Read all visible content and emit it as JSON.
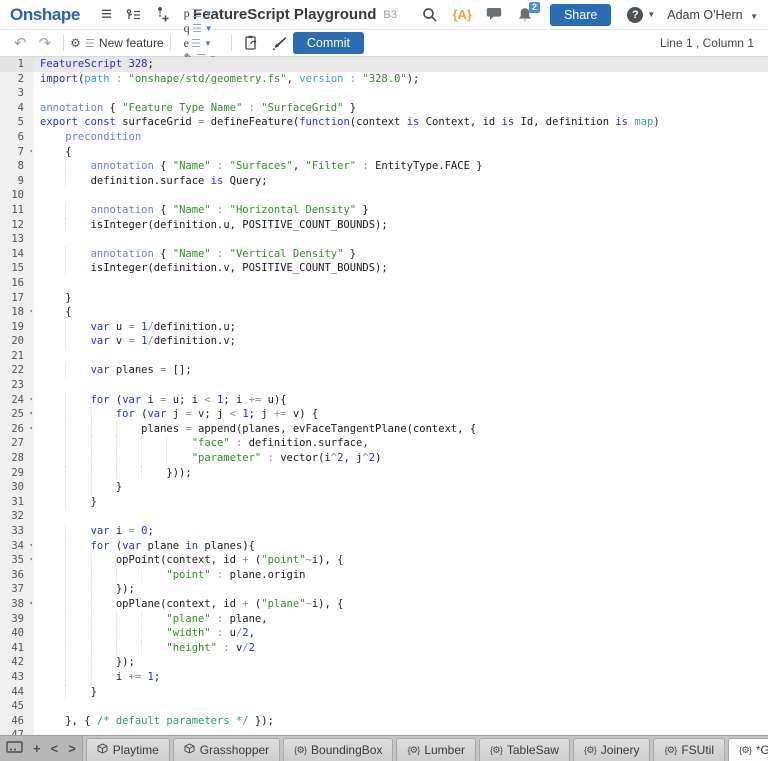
{
  "header": {
    "logo": "Onshape",
    "title": "FeatureScript Playground",
    "version_label": "B3",
    "fs_notices_label": "{A}",
    "notification_count": "2",
    "share_label": "Share",
    "help_label": "?",
    "user_name": "Adam O'Hern"
  },
  "toolbar": {
    "new_feature_label": "New feature",
    "snippet_buttons": [
      {
        "glyph": "p",
        "name": "toolbar-dropdown-p"
      },
      {
        "glyph": "q",
        "name": "toolbar-dropdown-q"
      },
      {
        "glyph": "e",
        "name": "toolbar-dropdown-e"
      },
      {
        "glyph": "✎",
        "name": "toolbar-dropdown-pencil"
      },
      {
        "glyph": "▣",
        "name": "toolbar-dropdown-box"
      }
    ],
    "commit_label": "Commit",
    "cursor_position": "Line 1 , Column 1"
  },
  "colors": {
    "accent_blue": "#2a6db4",
    "logo_blue": "#2b62b8",
    "badge_blue": "#4a90d9",
    "notice_orange": "#f2a33c",
    "keyword": "#2230d8",
    "string": "#2f8f23",
    "annotation": "#6b7edb",
    "parameter": "#3ba3c5",
    "comment": "#2f9b6b",
    "operator": "#8a8a8a"
  },
  "editor": {
    "lines": [
      {
        "n": 1,
        "ind": 0,
        "active": true,
        "t": [
          [
            "kw",
            "FeatureScript"
          ],
          [
            "pl",
            " "
          ],
          [
            "num",
            "328"
          ],
          [
            "pl",
            ";"
          ]
        ]
      },
      {
        "n": 2,
        "ind": 0,
        "t": [
          [
            "kw",
            "import"
          ],
          [
            "pl",
            "("
          ],
          [
            "par",
            "path"
          ],
          [
            "op",
            " : "
          ],
          [
            "str",
            "\"onshape/std/geometry.fs\""
          ],
          [
            "pl",
            ", "
          ],
          [
            "par",
            "version"
          ],
          [
            "op",
            " : "
          ],
          [
            "str",
            "\"328.0\""
          ],
          [
            "pl",
            ");"
          ]
        ]
      },
      {
        "n": 3,
        "ind": 0,
        "t": []
      },
      {
        "n": 4,
        "ind": 0,
        "t": [
          [
            "ann",
            "annotation"
          ],
          [
            "pl",
            " { "
          ],
          [
            "str",
            "\"Feature Type Name\""
          ],
          [
            "op",
            " : "
          ],
          [
            "str",
            "\"SurfaceGrid\""
          ],
          [
            "pl",
            " }"
          ]
        ]
      },
      {
        "n": 5,
        "ind": 0,
        "t": [
          [
            "kw",
            "export"
          ],
          [
            "pl",
            " "
          ],
          [
            "kw",
            "const"
          ],
          [
            "pl",
            " surfaceGrid "
          ],
          [
            "op",
            "="
          ],
          [
            "pl",
            " defineFeature("
          ],
          [
            "kw",
            "function"
          ],
          [
            "pl",
            "(context "
          ],
          [
            "kw",
            "is"
          ],
          [
            "pl",
            " Context, id "
          ],
          [
            "kw",
            "is"
          ],
          [
            "pl",
            " Id, definition "
          ],
          [
            "kw",
            "is"
          ],
          [
            "pl",
            " "
          ],
          [
            "par",
            "map"
          ],
          [
            "pl",
            ")"
          ]
        ]
      },
      {
        "n": 6,
        "ind": 4,
        "t": [
          [
            "ann",
            "precondition"
          ]
        ]
      },
      {
        "n": 7,
        "ind": 4,
        "fold": true,
        "t": [
          [
            "pl",
            "{"
          ]
        ]
      },
      {
        "n": 8,
        "ind": 8,
        "t": [
          [
            "ann",
            "annotation"
          ],
          [
            "pl",
            " { "
          ],
          [
            "str",
            "\"Name\""
          ],
          [
            "op",
            " : "
          ],
          [
            "str",
            "\"Surfaces\""
          ],
          [
            "pl",
            ", "
          ],
          [
            "str",
            "\"Filter\""
          ],
          [
            "op",
            " : "
          ],
          [
            "pl",
            "EntityType.FACE }"
          ]
        ]
      },
      {
        "n": 9,
        "ind": 8,
        "t": [
          [
            "pl",
            "definition.surface "
          ],
          [
            "kw",
            "is"
          ],
          [
            "pl",
            " Query;"
          ]
        ]
      },
      {
        "n": 10,
        "ind": 0,
        "t": []
      },
      {
        "n": 11,
        "ind": 8,
        "t": [
          [
            "ann",
            "annotation"
          ],
          [
            "pl",
            " { "
          ],
          [
            "str",
            "\"Name\""
          ],
          [
            "op",
            " : "
          ],
          [
            "str",
            "\"Horizontal Density\""
          ],
          [
            "pl",
            " }"
          ]
        ]
      },
      {
        "n": 12,
        "ind": 8,
        "t": [
          [
            "pl",
            "isInteger(definition.u, POSITIVE_COUNT_BOUNDS);"
          ]
        ]
      },
      {
        "n": 13,
        "ind": 0,
        "t": []
      },
      {
        "n": 14,
        "ind": 8,
        "t": [
          [
            "ann",
            "annotation"
          ],
          [
            "pl",
            " { "
          ],
          [
            "str",
            "\"Name\""
          ],
          [
            "op",
            " : "
          ],
          [
            "str",
            "\"Vertical Density\""
          ],
          [
            "pl",
            " }"
          ]
        ]
      },
      {
        "n": 15,
        "ind": 8,
        "t": [
          [
            "pl",
            "isInteger(definition.v, POSITIVE_COUNT_BOUNDS);"
          ]
        ]
      },
      {
        "n": 16,
        "ind": 0,
        "t": []
      },
      {
        "n": 17,
        "ind": 4,
        "t": [
          [
            "pl",
            "}"
          ]
        ]
      },
      {
        "n": 18,
        "ind": 4,
        "fold": true,
        "t": [
          [
            "pl",
            "{"
          ]
        ]
      },
      {
        "n": 19,
        "ind": 8,
        "t": [
          [
            "kw",
            "var"
          ],
          [
            "pl",
            " u "
          ],
          [
            "op",
            "="
          ],
          [
            "pl",
            " "
          ],
          [
            "num",
            "1"
          ],
          [
            "op",
            "/"
          ],
          [
            "pl",
            "definition.u;"
          ]
        ]
      },
      {
        "n": 20,
        "ind": 8,
        "t": [
          [
            "kw",
            "var"
          ],
          [
            "pl",
            " v "
          ],
          [
            "op",
            "="
          ],
          [
            "pl",
            " "
          ],
          [
            "num",
            "1"
          ],
          [
            "op",
            "/"
          ],
          [
            "pl",
            "definition.v;"
          ]
        ]
      },
      {
        "n": 21,
        "ind": 0,
        "t": []
      },
      {
        "n": 22,
        "ind": 8,
        "t": [
          [
            "kw",
            "var"
          ],
          [
            "pl",
            " planes "
          ],
          [
            "op",
            "="
          ],
          [
            "pl",
            " [];"
          ]
        ]
      },
      {
        "n": 23,
        "ind": 0,
        "t": []
      },
      {
        "n": 24,
        "ind": 8,
        "fold": true,
        "t": [
          [
            "kw",
            "for"
          ],
          [
            "pl",
            " ("
          ],
          [
            "kw",
            "var"
          ],
          [
            "pl",
            " i "
          ],
          [
            "op",
            "="
          ],
          [
            "pl",
            " u; i "
          ],
          [
            "op",
            "<"
          ],
          [
            "pl",
            " "
          ],
          [
            "num",
            "1"
          ],
          [
            "pl",
            "; i "
          ],
          [
            "op",
            "+="
          ],
          [
            "pl",
            " u){"
          ]
        ]
      },
      {
        "n": 25,
        "ind": 12,
        "fold": true,
        "t": [
          [
            "kw",
            "for"
          ],
          [
            "pl",
            " ("
          ],
          [
            "kw",
            "var"
          ],
          [
            "pl",
            " j "
          ],
          [
            "op",
            "="
          ],
          [
            "pl",
            " v; j "
          ],
          [
            "op",
            "<"
          ],
          [
            "pl",
            " "
          ],
          [
            "num",
            "1"
          ],
          [
            "pl",
            "; j "
          ],
          [
            "op",
            "+="
          ],
          [
            "pl",
            " v) {"
          ]
        ]
      },
      {
        "n": 26,
        "ind": 16,
        "fold": true,
        "t": [
          [
            "pl",
            "planes "
          ],
          [
            "op",
            "="
          ],
          [
            "pl",
            " append(planes, evFaceTangentPlane(context, {"
          ]
        ]
      },
      {
        "n": 27,
        "ind": 24,
        "t": [
          [
            "str",
            "\"face\""
          ],
          [
            "op",
            " : "
          ],
          [
            "pl",
            "definition.surface,"
          ]
        ]
      },
      {
        "n": 28,
        "ind": 24,
        "t": [
          [
            "str",
            "\"parameter\""
          ],
          [
            "op",
            " : "
          ],
          [
            "pl",
            "vector(i"
          ],
          [
            "op",
            "^"
          ],
          [
            "num",
            "2"
          ],
          [
            "pl",
            ", j"
          ],
          [
            "op",
            "^"
          ],
          [
            "num",
            "2"
          ],
          [
            "pl",
            ")"
          ]
        ]
      },
      {
        "n": 29,
        "ind": 20,
        "t": [
          [
            "pl",
            "}));"
          ]
        ]
      },
      {
        "n": 30,
        "ind": 12,
        "t": [
          [
            "pl",
            "}"
          ]
        ]
      },
      {
        "n": 31,
        "ind": 8,
        "t": [
          [
            "pl",
            "}"
          ]
        ]
      },
      {
        "n": 32,
        "ind": 0,
        "t": []
      },
      {
        "n": 33,
        "ind": 8,
        "t": [
          [
            "kw",
            "var"
          ],
          [
            "pl",
            " i "
          ],
          [
            "op",
            "="
          ],
          [
            "pl",
            " "
          ],
          [
            "num",
            "0"
          ],
          [
            "pl",
            ";"
          ]
        ]
      },
      {
        "n": 34,
        "ind": 8,
        "fold": true,
        "t": [
          [
            "kw",
            "for"
          ],
          [
            "pl",
            " ("
          ],
          [
            "kw",
            "var"
          ],
          [
            "pl",
            " plane "
          ],
          [
            "kw",
            "in"
          ],
          [
            "pl",
            " planes){"
          ]
        ]
      },
      {
        "n": 35,
        "ind": 12,
        "fold": true,
        "t": [
          [
            "pl",
            "opPoint(context, id "
          ],
          [
            "op",
            "+"
          ],
          [
            "pl",
            " ("
          ],
          [
            "str",
            "\"point\""
          ],
          [
            "op",
            "~"
          ],
          [
            "pl",
            "i), {"
          ]
        ]
      },
      {
        "n": 36,
        "ind": 20,
        "t": [
          [
            "str",
            "\"point\""
          ],
          [
            "op",
            " : "
          ],
          [
            "pl",
            "plane.origin"
          ]
        ]
      },
      {
        "n": 37,
        "ind": 12,
        "t": [
          [
            "pl",
            "});"
          ]
        ]
      },
      {
        "n": 38,
        "ind": 12,
        "fold": true,
        "t": [
          [
            "pl",
            "opPlane(context, id "
          ],
          [
            "op",
            "+"
          ],
          [
            "pl",
            " ("
          ],
          [
            "str",
            "\"plane\""
          ],
          [
            "op",
            "~"
          ],
          [
            "pl",
            "i), {"
          ]
        ]
      },
      {
        "n": 39,
        "ind": 20,
        "t": [
          [
            "str",
            "\"plane\""
          ],
          [
            "op",
            " : "
          ],
          [
            "pl",
            "plane,"
          ]
        ]
      },
      {
        "n": 40,
        "ind": 20,
        "t": [
          [
            "str",
            "\"width\""
          ],
          [
            "op",
            " : "
          ],
          [
            "pl",
            "u"
          ],
          [
            "op",
            "/"
          ],
          [
            "num",
            "2"
          ],
          [
            "pl",
            ","
          ]
        ]
      },
      {
        "n": 41,
        "ind": 20,
        "t": [
          [
            "str",
            "\"height\""
          ],
          [
            "op",
            " : "
          ],
          [
            "pl",
            "v"
          ],
          [
            "op",
            "/"
          ],
          [
            "num",
            "2"
          ]
        ]
      },
      {
        "n": 42,
        "ind": 12,
        "t": [
          [
            "pl",
            "});"
          ]
        ]
      },
      {
        "n": 43,
        "ind": 12,
        "t": [
          [
            "pl",
            "i "
          ],
          [
            "op",
            "+="
          ],
          [
            "pl",
            " "
          ],
          [
            "num",
            "1"
          ],
          [
            "pl",
            ";"
          ]
        ]
      },
      {
        "n": 44,
        "ind": 8,
        "t": [
          [
            "pl",
            "}"
          ]
        ]
      },
      {
        "n": 45,
        "ind": 0,
        "t": []
      },
      {
        "n": 46,
        "ind": 4,
        "t": [
          [
            "pl",
            "}, { "
          ],
          [
            "com",
            "/* default parameters */"
          ],
          [
            "pl",
            " });"
          ]
        ]
      },
      {
        "n": 47,
        "ind": 0,
        "t": []
      }
    ]
  },
  "tabbar": {
    "tabs": [
      {
        "icon": "partstudio",
        "label": "Playtime"
      },
      {
        "icon": "partstudio",
        "label": "Grasshopper"
      },
      {
        "icon": "featurescript",
        "label": "BoundingBox"
      },
      {
        "icon": "featurescript",
        "label": "Lumber"
      },
      {
        "icon": "featurescript",
        "label": "TableSaw"
      },
      {
        "icon": "featurescript",
        "label": "Joinery"
      },
      {
        "icon": "featurescript",
        "label": "FSUtil"
      },
      {
        "icon": "featurescript",
        "label": "*GrasshopperFeatur...",
        "active": true
      }
    ],
    "fs_icon_glyph": "{⚙}"
  }
}
